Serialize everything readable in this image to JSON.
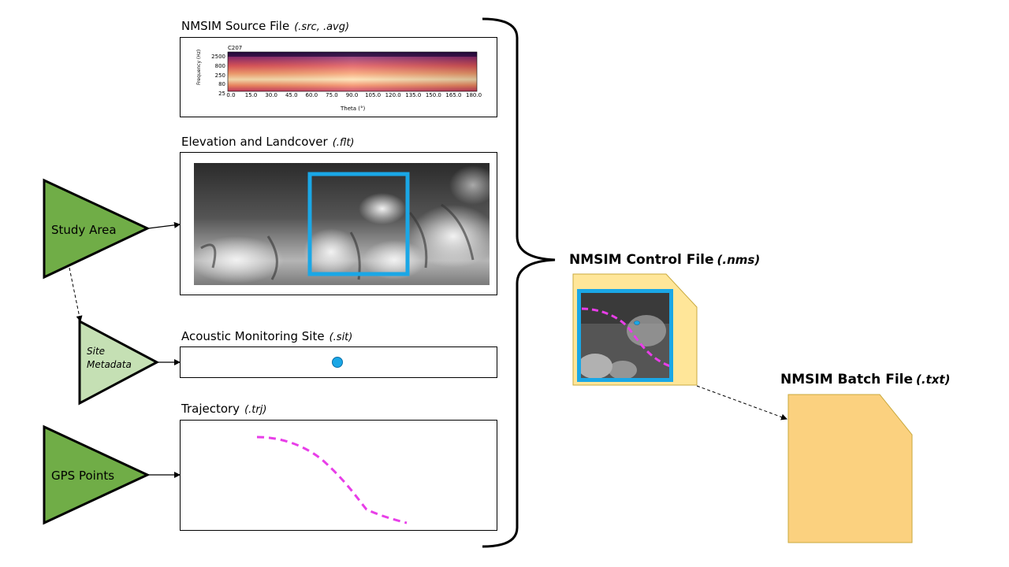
{
  "source_panel": {
    "title": "NMSIM Source File",
    "ext": "(.src, .avg)",
    "spectrogram": {
      "label": "C207",
      "ylabel": "Frequency (Hz)",
      "xlabel": "Theta (°)",
      "y_ticks": [
        "2500",
        "800",
        "250",
        "80",
        "25"
      ],
      "x_ticks": [
        "0.0",
        "15.0",
        "30.0",
        "45.0",
        "60.0",
        "75.0",
        "90.0",
        "105.0",
        "120.0",
        "135.0",
        "150.0",
        "165.0",
        "180.0"
      ]
    }
  },
  "elevation_panel": {
    "title": "Elevation  and Landcover",
    "ext": "(.flt)"
  },
  "site_panel": {
    "title": "Acoustic Monitoring Site",
    "ext": "(.sit)"
  },
  "trajectory_panel": {
    "title": "Trajectory",
    "ext": "(.trj)"
  },
  "study_area": {
    "label": "Study Area"
  },
  "site_metadata": {
    "line1": "Site",
    "line2": "Metadata"
  },
  "gps_points": {
    "label": "GPS Points"
  },
  "control_file": {
    "title": "NMSIM Control File",
    "ext": "(.nms)"
  },
  "batch_file": {
    "title": "NMSIM Batch File",
    "ext": "(.txt)"
  },
  "colors": {
    "input_green": "#70ad47",
    "metadata_green": "#c5e0b4",
    "site_blue": "#1aa7e6",
    "trajectory_magenta": "#e83ee8",
    "control_file_fill": "#ffe699",
    "batch_file_fill": "#fbd17f"
  }
}
